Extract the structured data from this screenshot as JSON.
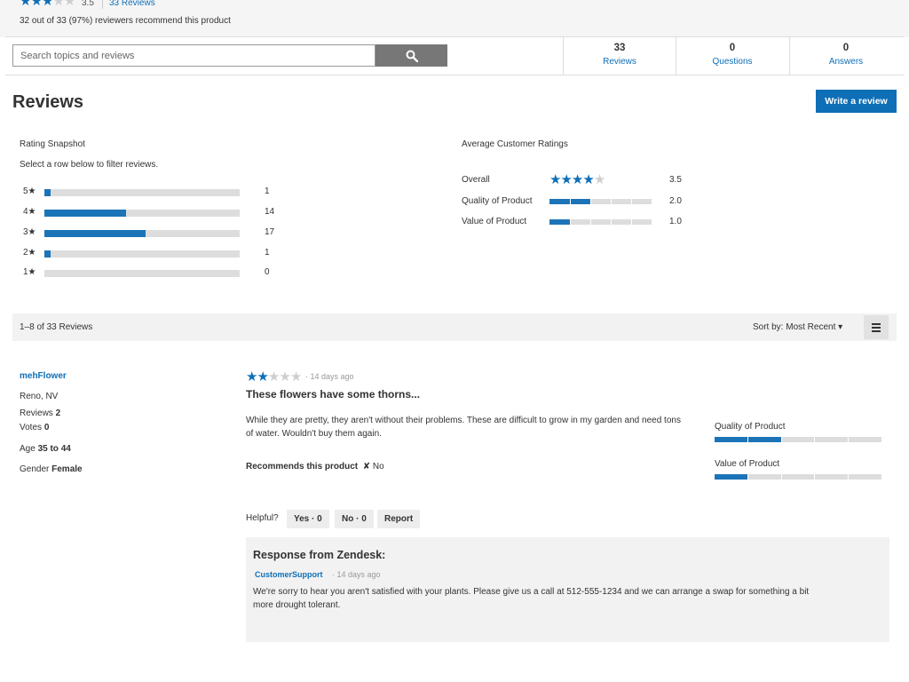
{
  "summary": {
    "rating": "3.5",
    "reviews_link": "33 Reviews",
    "recommend_text": "32 out of 33 (97%) reviewers recommend this product"
  },
  "search": {
    "placeholder": "Search topics and reviews",
    "button_icon": "search-icon"
  },
  "count_tabs": [
    {
      "count": "33",
      "label": "Reviews"
    },
    {
      "count": "0",
      "label": "Questions"
    },
    {
      "count": "0",
      "label": "Answers"
    }
  ],
  "heading": "Reviews",
  "write_review_label": "Write a review",
  "snapshot": {
    "title": "Rating Snapshot",
    "subtitle": "Select a row below to filter reviews.",
    "rows": [
      {
        "label": "5★",
        "count": "1",
        "fraction": 0.03
      },
      {
        "label": "4★",
        "count": "14",
        "fraction": 0.42
      },
      {
        "label": "3★",
        "count": "17",
        "fraction": 0.52
      },
      {
        "label": "2★",
        "count": "1",
        "fraction": 0.03
      },
      {
        "label": "1★",
        "count": "0",
        "fraction": 0
      }
    ]
  },
  "average": {
    "title": "Average Customer Ratings",
    "overall_label": "Overall",
    "overall_value": "3.5",
    "items": [
      {
        "label": "Quality of Product",
        "value": "2.0",
        "level": 2
      },
      {
        "label": "Value of Product",
        "value": "1.0",
        "level": 1
      }
    ]
  },
  "toolbar": {
    "range": "1–8 of 33 Reviews",
    "sort_label": "Sort by: Most Recent ▾",
    "menu_icon": "menu-icon"
  },
  "review": {
    "reviewer": "mehFlower",
    "location": "Reno, NV",
    "reviews_label": "Reviews",
    "reviews_count": "2",
    "votes_label": "Votes",
    "votes_count": "0",
    "age_label": "Age",
    "age_value": "35 to 44",
    "gender_label": "Gender",
    "gender_value": "Female",
    "rating": 2,
    "date": "· 14 days ago",
    "title": "These flowers have some thorns...",
    "body": "While they are pretty, they aren't without their problems. These are difficult to grow in my garden and need tons of water. Wouldn't buy them again.",
    "recommend_label": "Recommends this product",
    "recommend_value": "✘ No",
    "secondary": [
      {
        "label": "Quality of Product",
        "level": 2
      },
      {
        "label": "Value of Product",
        "level": 1
      }
    ],
    "helpful_label": "Helpful?",
    "yes_label": "Yes · 0",
    "no_label": "No · 0",
    "report_label": "Report"
  },
  "response": {
    "title": "Response from Zendesk:",
    "author": "CustomerSupport",
    "date": "· 14 days ago",
    "body": "We're sorry to hear you aren't satisfied with your plants. Please give us a call at 512-555-1234 and we can arrange a swap for something a bit more drought tolerant."
  }
}
